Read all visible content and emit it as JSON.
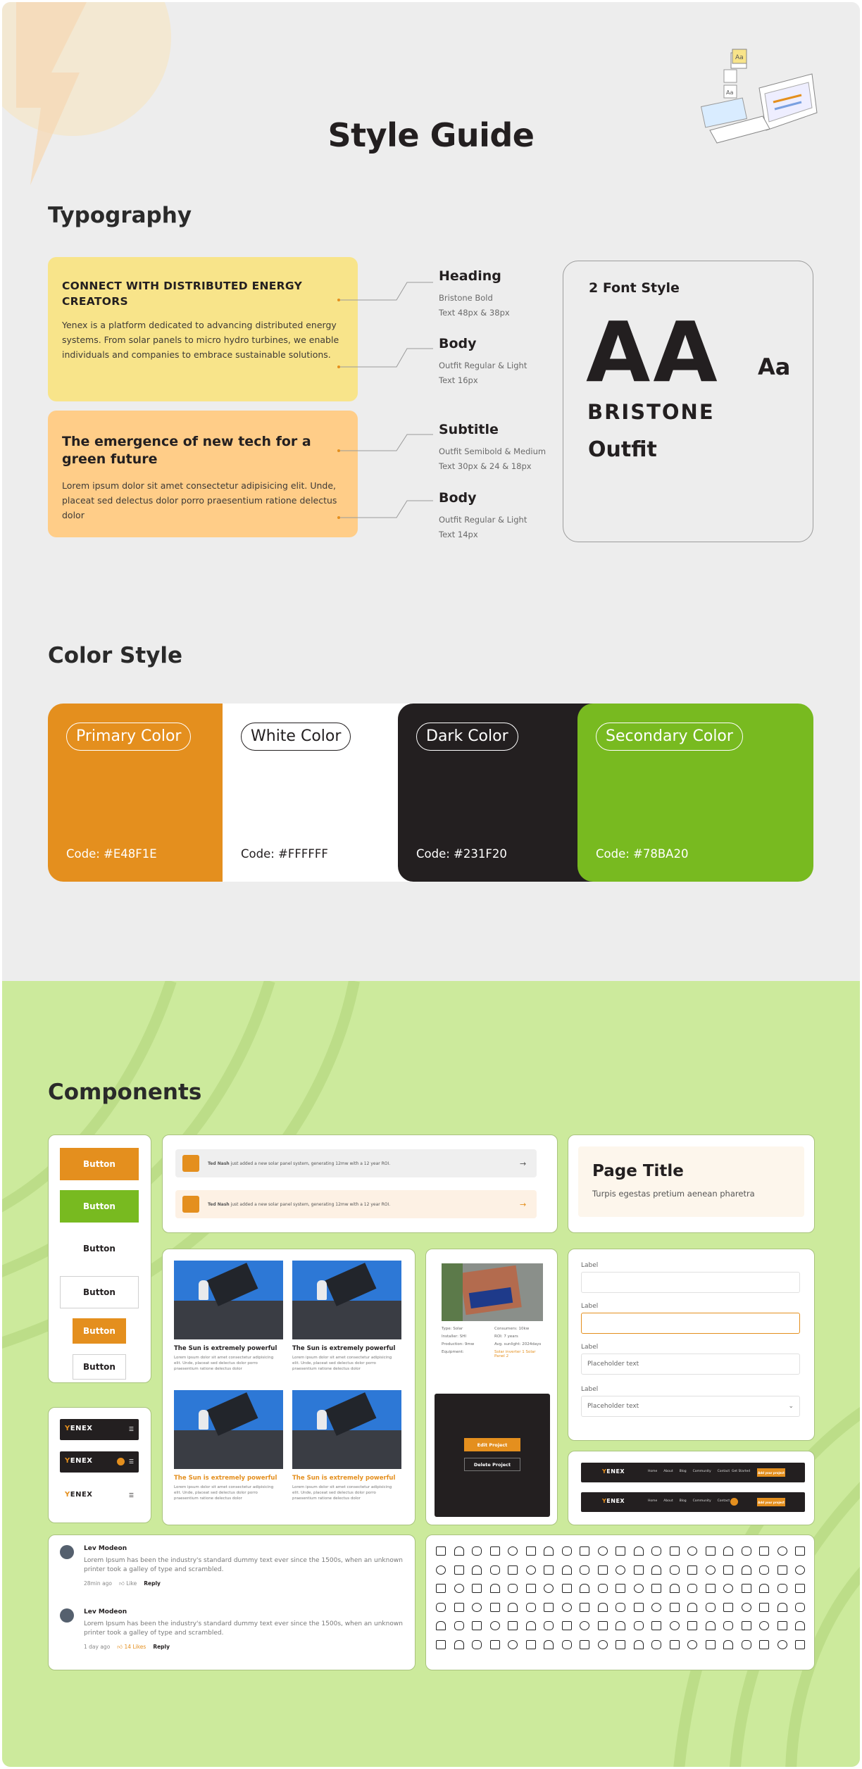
{
  "page_title": "Style Guide",
  "typography": {
    "section_title": "Typography",
    "sample1": {
      "heading": "CONNECT WITH DISTRIBUTED ENERGY CREATORS",
      "body": "Yenex is a platform dedicated to advancing distributed energy systems. From solar panels to micro hydro turbines, we enable individuals and companies to embrace sustainable solutions."
    },
    "sample2": {
      "subtitle": "The emergence of new tech for a green future",
      "body": "Lorem ipsum dolor sit amet consectetur adipisicing elit. Unde, placeat sed delectus dolor porro praesentium ratione delectus dolor"
    },
    "specs": [
      {
        "name": "Heading",
        "line1": "Bristone Bold",
        "line2": "Text 48px & 38px"
      },
      {
        "name": "Body",
        "line1": "Outfit Regular & Light",
        "line2": "Text 16px"
      },
      {
        "name": "Subtitle",
        "line1": "Outfit Semibold & Medium",
        "line2": "Text 30px & 24 & 18px"
      },
      {
        "name": "Body",
        "line1": "Outfit Regular & Light",
        "line2": "Text 14px"
      }
    ],
    "font_box": {
      "label": "2 Font Style",
      "big": "AA",
      "small": "Aa",
      "font1": "BRISTONE",
      "font2": "Outfit"
    }
  },
  "color_style": {
    "section_title": "Color Style",
    "swatches": [
      {
        "name": "Primary Color",
        "code": "Code: #E48F1E",
        "color": "#E48F1E",
        "text_color": "#FFFFFF"
      },
      {
        "name": "White Color",
        "code": "Code: #FFFFFF",
        "color": "#FFFFFF",
        "text_color": "#231F20"
      },
      {
        "name": "Dark Color",
        "code": "Code: #231F20",
        "color": "#231F20",
        "text_color": "#FFFFFF"
      },
      {
        "name": "Secondary Color",
        "code": "Code: #78BA20",
        "color": "#78BA20",
        "text_color": "#FFFFFF"
      }
    ]
  },
  "components": {
    "section_title": "Components",
    "button_label": "Button",
    "notifications": [
      {
        "name": "Ted Nash",
        "text": " just added a new solar panel system, generating 12mw with a 12 year ROI."
      },
      {
        "name": "Ted Nash",
        "text": " just added a new solar panel system, generating 12mw with a 12 year ROI."
      }
    ],
    "page_title_card": {
      "title": "Page Title",
      "subtitle": "Turpis egestas pretium aenean pharetra"
    },
    "posts": [
      {
        "title": "The Sun is extremely powerful",
        "desc": "Lorem ipsum dolor sit amet consectetur adipisicing elit. Unde, placeat sed delectus dolor porro praesentium ratione delectus dolor",
        "highlight": false
      },
      {
        "title": "The Sun is extremely powerful",
        "desc": "Lorem ipsum dolor sit amet consectetur adipisicing elit. Unde, placeat sed delectus dolor porro praesentium ratione delectus dolor",
        "highlight": false
      },
      {
        "title": "The Sun is extremely powerful",
        "desc": "Lorem ipsum dolor sit amet consectetur adipisicing elit. Unde, placeat sed delectus dolor porro praesentium ratione delectus dolor",
        "highlight": true
      },
      {
        "title": "The Sun is extremely powerful",
        "desc": "Lorem ipsum dolor sit amet consectetur adipisicing elit. Unde, placeat sed delectus dolor porro praesentium ratione delectus dolor",
        "highlight": true
      }
    ],
    "project": {
      "rows": [
        [
          "Type: Solar",
          "Consumers: 10kw"
        ],
        [
          "Installer: SHI",
          "ROI: 7 years"
        ],
        [
          "Production: 9mw",
          "Avg. sunlight: 2024days"
        ],
        [
          "Equipment:",
          "Solar inverter 1 Solar Panel 2"
        ]
      ],
      "edit": "Edit Project",
      "delete": "Delete Project"
    },
    "form": {
      "label": "Label",
      "placeholder": "Placeholder text"
    },
    "logo": {
      "first": "Y",
      "rest": "ENEX"
    },
    "nav_links": [
      "Home",
      "About",
      "Blog",
      "Community",
      "Contact"
    ],
    "nav_login": "Get Started",
    "nav_cta": "Add your project",
    "comments": [
      {
        "name": "Lev Modeon",
        "text": "Lorem Ipsum has been the industry's standard dummy text ever since the 1500s, when an unknown printer took a galley of type and scrambled.",
        "time": "28min ago",
        "like": "Like",
        "reply": "Reply"
      },
      {
        "name": "Lev Modeon",
        "text": "Lorem Ipsum has been the industry's standard dummy text ever since the 1500s, when an unknown printer took a galley of type and scrambled.",
        "time": "1 day ago",
        "like": "14 Likes",
        "reply": "Reply"
      }
    ]
  }
}
